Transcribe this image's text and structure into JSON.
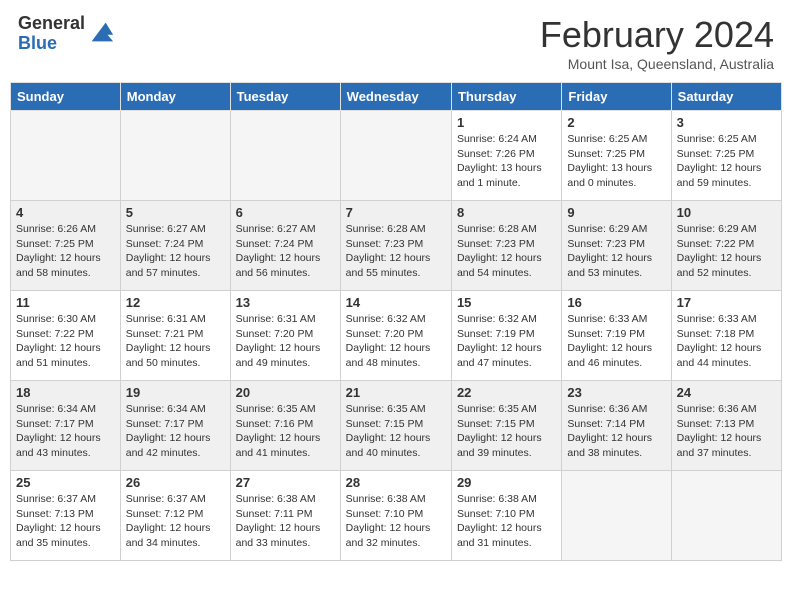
{
  "header": {
    "logo": {
      "general": "General",
      "blue": "Blue"
    },
    "title": "February 2024",
    "location": "Mount Isa, Queensland, Australia"
  },
  "calendar": {
    "days_of_week": [
      "Sunday",
      "Monday",
      "Tuesday",
      "Wednesday",
      "Thursday",
      "Friday",
      "Saturday"
    ],
    "weeks": [
      [
        {
          "day": "",
          "info": ""
        },
        {
          "day": "",
          "info": ""
        },
        {
          "day": "",
          "info": ""
        },
        {
          "day": "",
          "info": ""
        },
        {
          "day": "1",
          "info": "Sunrise: 6:24 AM\nSunset: 7:26 PM\nDaylight: 13 hours and 1 minute."
        },
        {
          "day": "2",
          "info": "Sunrise: 6:25 AM\nSunset: 7:25 PM\nDaylight: 13 hours and 0 minutes."
        },
        {
          "day": "3",
          "info": "Sunrise: 6:25 AM\nSunset: 7:25 PM\nDaylight: 12 hours and 59 minutes."
        }
      ],
      [
        {
          "day": "4",
          "info": "Sunrise: 6:26 AM\nSunset: 7:25 PM\nDaylight: 12 hours and 58 minutes."
        },
        {
          "day": "5",
          "info": "Sunrise: 6:27 AM\nSunset: 7:24 PM\nDaylight: 12 hours and 57 minutes."
        },
        {
          "day": "6",
          "info": "Sunrise: 6:27 AM\nSunset: 7:24 PM\nDaylight: 12 hours and 56 minutes."
        },
        {
          "day": "7",
          "info": "Sunrise: 6:28 AM\nSunset: 7:23 PM\nDaylight: 12 hours and 55 minutes."
        },
        {
          "day": "8",
          "info": "Sunrise: 6:28 AM\nSunset: 7:23 PM\nDaylight: 12 hours and 54 minutes."
        },
        {
          "day": "9",
          "info": "Sunrise: 6:29 AM\nSunset: 7:23 PM\nDaylight: 12 hours and 53 minutes."
        },
        {
          "day": "10",
          "info": "Sunrise: 6:29 AM\nSunset: 7:22 PM\nDaylight: 12 hours and 52 minutes."
        }
      ],
      [
        {
          "day": "11",
          "info": "Sunrise: 6:30 AM\nSunset: 7:22 PM\nDaylight: 12 hours and 51 minutes."
        },
        {
          "day": "12",
          "info": "Sunrise: 6:31 AM\nSunset: 7:21 PM\nDaylight: 12 hours and 50 minutes."
        },
        {
          "day": "13",
          "info": "Sunrise: 6:31 AM\nSunset: 7:20 PM\nDaylight: 12 hours and 49 minutes."
        },
        {
          "day": "14",
          "info": "Sunrise: 6:32 AM\nSunset: 7:20 PM\nDaylight: 12 hours and 48 minutes."
        },
        {
          "day": "15",
          "info": "Sunrise: 6:32 AM\nSunset: 7:19 PM\nDaylight: 12 hours and 47 minutes."
        },
        {
          "day": "16",
          "info": "Sunrise: 6:33 AM\nSunset: 7:19 PM\nDaylight: 12 hours and 46 minutes."
        },
        {
          "day": "17",
          "info": "Sunrise: 6:33 AM\nSunset: 7:18 PM\nDaylight: 12 hours and 44 minutes."
        }
      ],
      [
        {
          "day": "18",
          "info": "Sunrise: 6:34 AM\nSunset: 7:17 PM\nDaylight: 12 hours and 43 minutes."
        },
        {
          "day": "19",
          "info": "Sunrise: 6:34 AM\nSunset: 7:17 PM\nDaylight: 12 hours and 42 minutes."
        },
        {
          "day": "20",
          "info": "Sunrise: 6:35 AM\nSunset: 7:16 PM\nDaylight: 12 hours and 41 minutes."
        },
        {
          "day": "21",
          "info": "Sunrise: 6:35 AM\nSunset: 7:15 PM\nDaylight: 12 hours and 40 minutes."
        },
        {
          "day": "22",
          "info": "Sunrise: 6:35 AM\nSunset: 7:15 PM\nDaylight: 12 hours and 39 minutes."
        },
        {
          "day": "23",
          "info": "Sunrise: 6:36 AM\nSunset: 7:14 PM\nDaylight: 12 hours and 38 minutes."
        },
        {
          "day": "24",
          "info": "Sunrise: 6:36 AM\nSunset: 7:13 PM\nDaylight: 12 hours and 37 minutes."
        }
      ],
      [
        {
          "day": "25",
          "info": "Sunrise: 6:37 AM\nSunset: 7:13 PM\nDaylight: 12 hours and 35 minutes."
        },
        {
          "day": "26",
          "info": "Sunrise: 6:37 AM\nSunset: 7:12 PM\nDaylight: 12 hours and 34 minutes."
        },
        {
          "day": "27",
          "info": "Sunrise: 6:38 AM\nSunset: 7:11 PM\nDaylight: 12 hours and 33 minutes."
        },
        {
          "day": "28",
          "info": "Sunrise: 6:38 AM\nSunset: 7:10 PM\nDaylight: 12 hours and 32 minutes."
        },
        {
          "day": "29",
          "info": "Sunrise: 6:38 AM\nSunset: 7:10 PM\nDaylight: 12 hours and 31 minutes."
        },
        {
          "day": "",
          "info": ""
        },
        {
          "day": "",
          "info": ""
        }
      ]
    ]
  }
}
